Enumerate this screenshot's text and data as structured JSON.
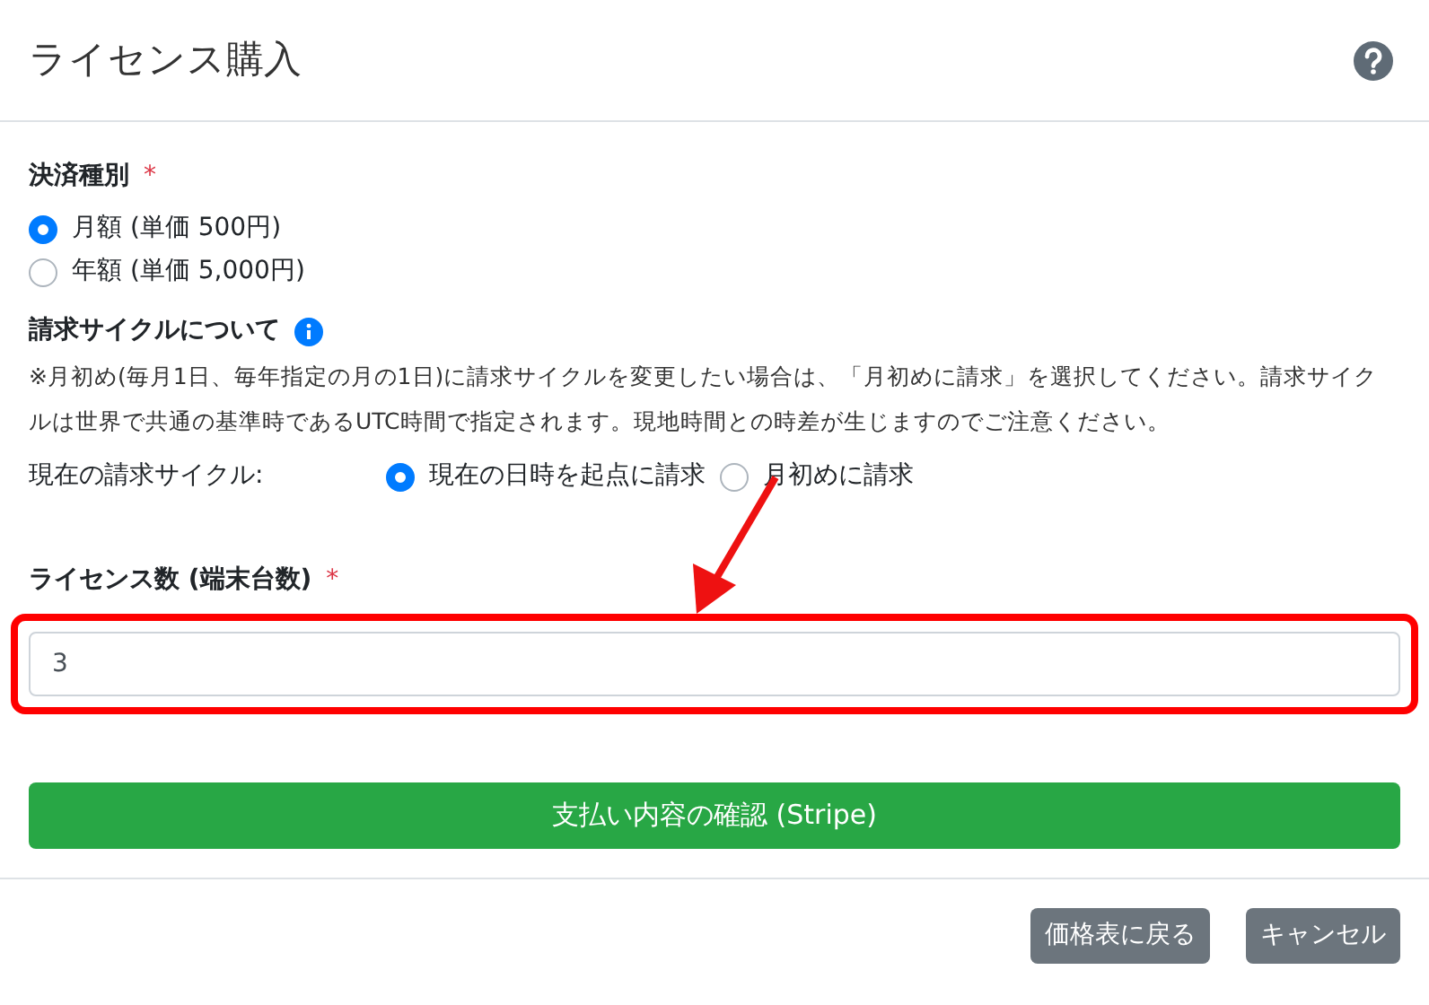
{
  "dialog": {
    "title": "ライセンス購入"
  },
  "payment_type": {
    "label": "決済種別",
    "required_mark": "*",
    "options": [
      {
        "label": "月額 (単価 500円)",
        "selected": true
      },
      {
        "label": "年額 (単価 5,000円)",
        "selected": false
      }
    ]
  },
  "billing_cycle": {
    "heading": "請求サイクルについて",
    "note": "※月初め(毎月1日、毎年指定の月の1日)に請求サイクルを変更したい場合は、「月初めに請求」を選択してください。請求サイクルは世界で共通の基準時であるUTC時間で指定されます。現地時間との時差が生じますのでご注意ください。",
    "current_label": "現在の請求サイクル:",
    "options": [
      {
        "label": "現在の日時を起点に請求",
        "selected": true
      },
      {
        "label": "月初めに請求",
        "selected": false
      }
    ]
  },
  "license_count": {
    "label": "ライセンス数 (端末台数)",
    "required_mark": "*",
    "value": "3",
    "highlighted": true
  },
  "confirm_button": "支払い内容の確認 (Stripe)",
  "footer_buttons": [
    "価格表に戻る",
    "キャンセル"
  ]
}
